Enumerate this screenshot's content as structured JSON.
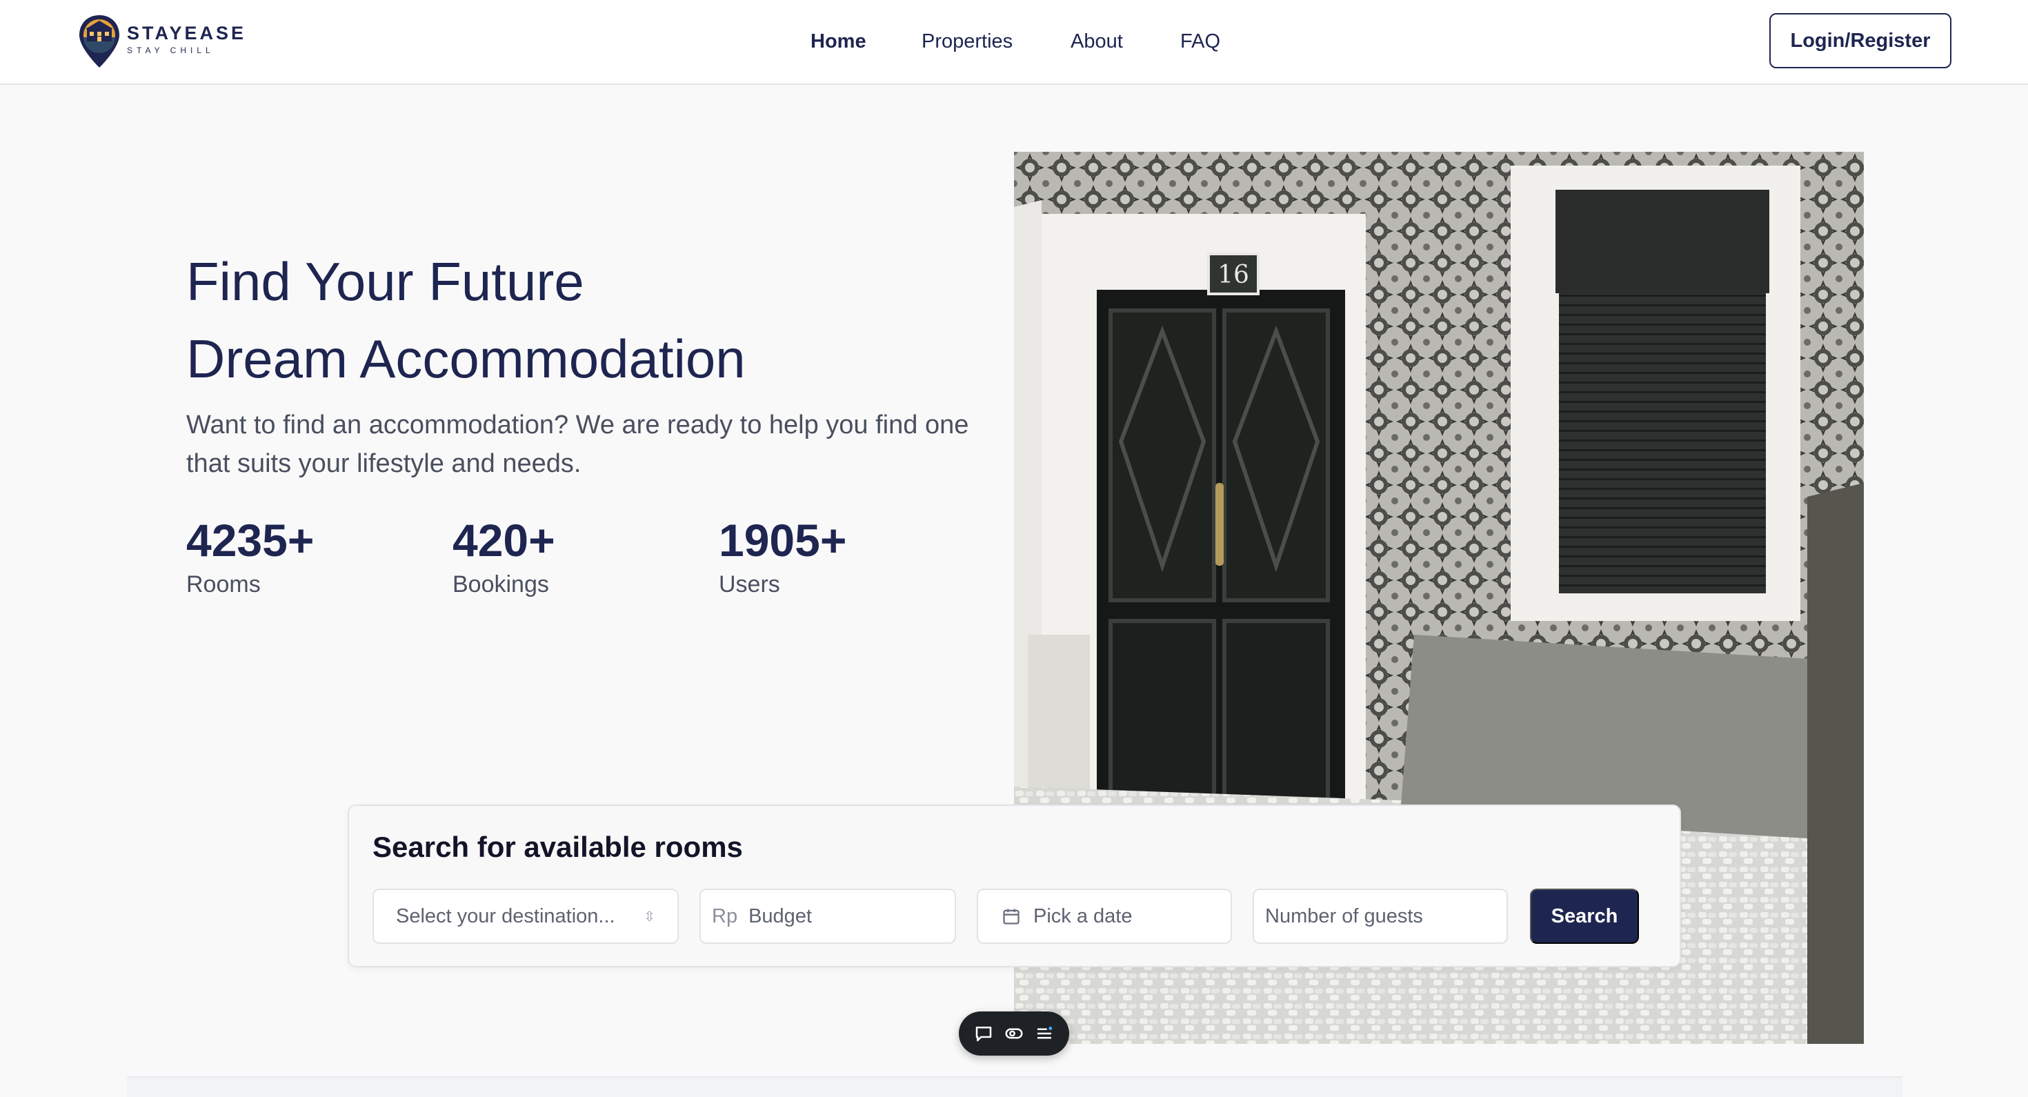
{
  "brand": {
    "name": "STAYEASE",
    "tagline": "STAY CHILL",
    "logo_icon": "map-pin-house-logo"
  },
  "nav": {
    "links": [
      {
        "label": "Home",
        "active": true
      },
      {
        "label": "Properties",
        "active": false
      },
      {
        "label": "About",
        "active": false
      },
      {
        "label": "FAQ",
        "active": false
      }
    ],
    "login_label": "Login/Register"
  },
  "hero": {
    "title_line1": "Find Your Future",
    "title_line2": "Dream Accommodation",
    "subtitle": "Want to find an accommodation? We are ready to help you find one that suits your lifestyle and needs.",
    "stats": [
      {
        "value": "4235+",
        "label": "Rooms"
      },
      {
        "value": "420+",
        "label": "Bookings"
      },
      {
        "value": "1905+",
        "label": "Users"
      }
    ],
    "image": "photo of a black wooden door numbered 16 in a tiled white-framed wall with a shuttered window"
  },
  "search": {
    "title": "Search for available rooms",
    "destination_placeholder": "Select your destination...",
    "budget_prefix": "Rp",
    "budget_placeholder": "Budget",
    "date_placeholder": "Pick a date",
    "guests_placeholder": "Number of guests",
    "button_label": "Search"
  },
  "toolbar": {
    "icons": [
      "chat-bubble-icon",
      "eye-toggle-icon",
      "list-menu-icon"
    ]
  },
  "colors": {
    "primary": "#1e2550",
    "text_muted": "#4a4f5e",
    "background": "#f9f9fa",
    "border": "#e1e3e7"
  }
}
